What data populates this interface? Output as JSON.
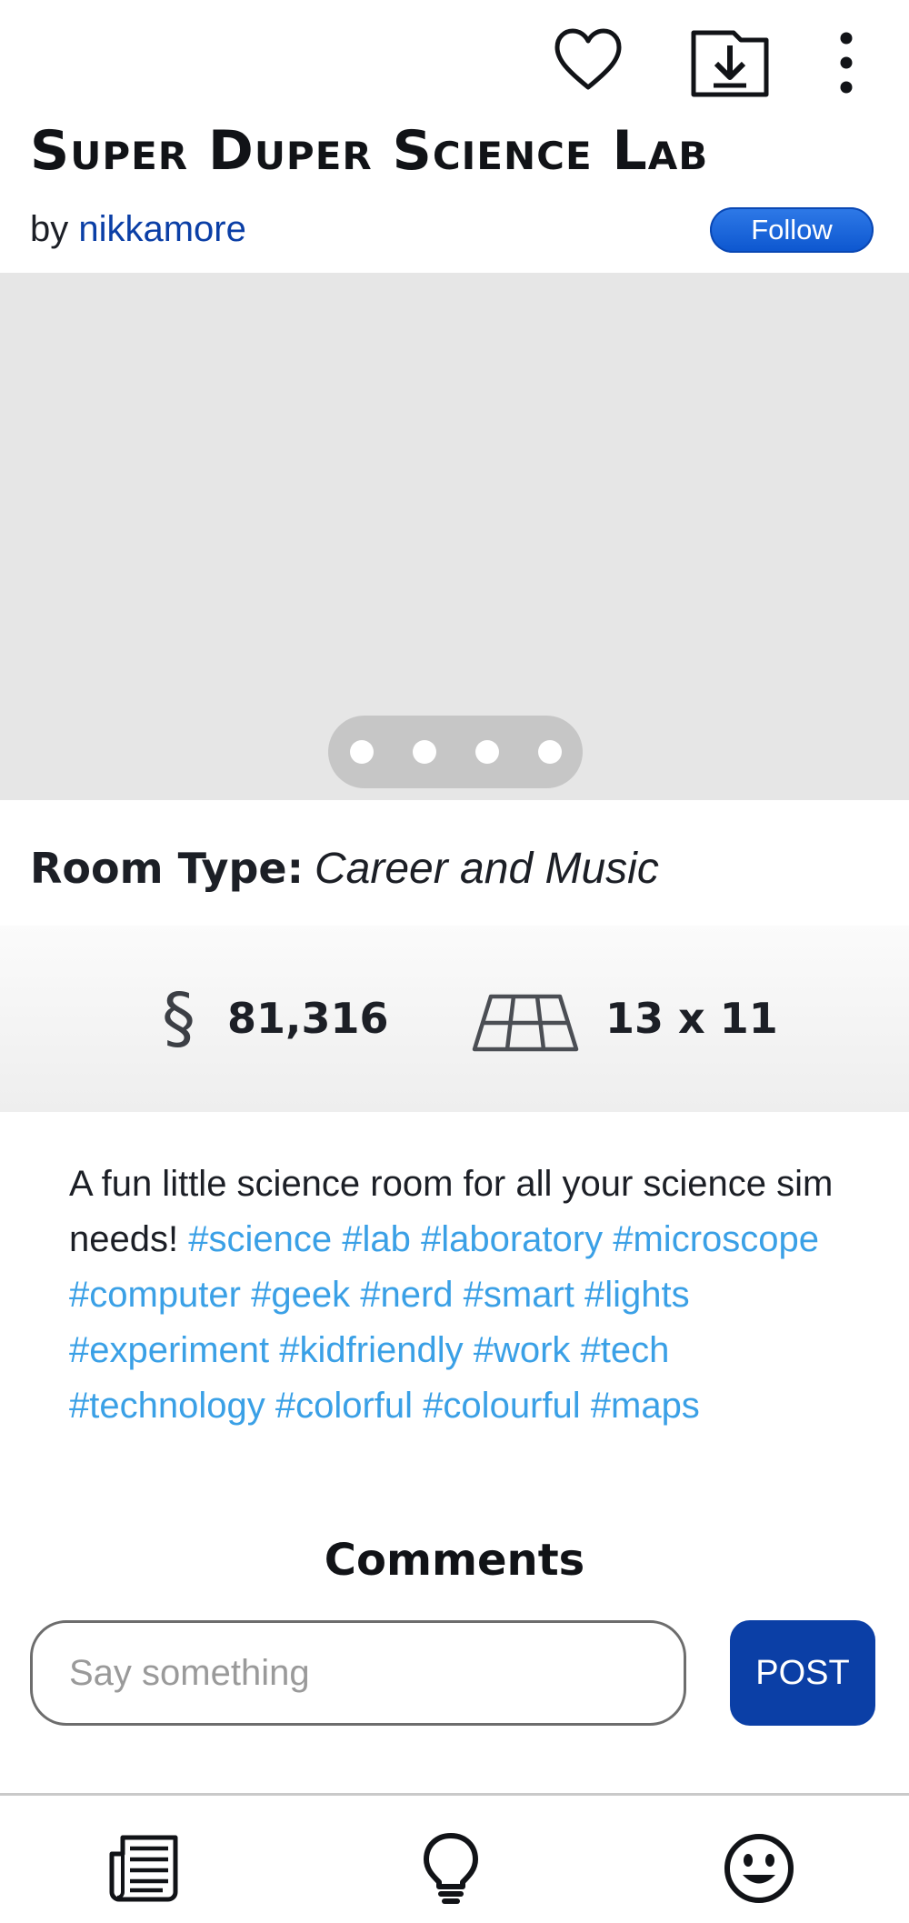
{
  "header": {
    "title": "Super Duper Science Lab",
    "by_prefix": "by ",
    "author": "nikkamore",
    "follow_label": "Follow",
    "action_icons": [
      "heart-icon",
      "download-icon",
      "more-vertical-icon"
    ]
  },
  "gallery": {
    "image_count": 4,
    "current_index": 0
  },
  "room": {
    "type_label": "Room Type:",
    "type_value": "Career and Music",
    "price_symbol": "§",
    "price": "81,316",
    "size": "13 x 11"
  },
  "description": {
    "text": "A fun little science room for all your science sim needs!",
    "hashtags": [
      "#science",
      "#lab",
      "#laboratory",
      "#microscope",
      "#computer",
      "#geek",
      "#nerd",
      "#smart",
      "#lights",
      "#experiment",
      "#kidfriendly",
      "#work",
      "#tech",
      "#technology",
      "#colorful",
      "#colourful",
      "#maps"
    ]
  },
  "comments": {
    "heading": "Comments",
    "input_placeholder": "Say something",
    "post_label": "POST"
  },
  "bottom_nav": {
    "items": [
      {
        "icon": "newspaper-icon"
      },
      {
        "icon": "lightbulb-icon"
      },
      {
        "icon": "smiley-icon"
      }
    ]
  },
  "colors": {
    "author": "#0b3fa6",
    "follow_button": "#1565d8",
    "hashtag": "#3aa0e6",
    "post_button": "#0b3fa6",
    "gallery_bg": "#e6e6e6"
  }
}
